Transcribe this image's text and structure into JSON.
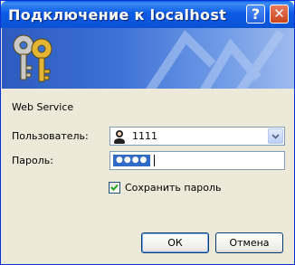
{
  "window": {
    "title": "Подключение к localhost",
    "help_glyph": "?",
    "close_glyph": "✕"
  },
  "service_text": "Web Service",
  "user": {
    "label": "Пользователь:",
    "value": "1111",
    "icon": "user-icon"
  },
  "password": {
    "label": "Пароль:",
    "mask": "●●●●"
  },
  "save_password": {
    "label": "Сохранить пароль",
    "checked": true
  },
  "buttons": {
    "ok": "ОК",
    "cancel": "Отмена"
  },
  "colors": {
    "titlebar": "#0a5fe8",
    "accent": "#316ac5"
  }
}
